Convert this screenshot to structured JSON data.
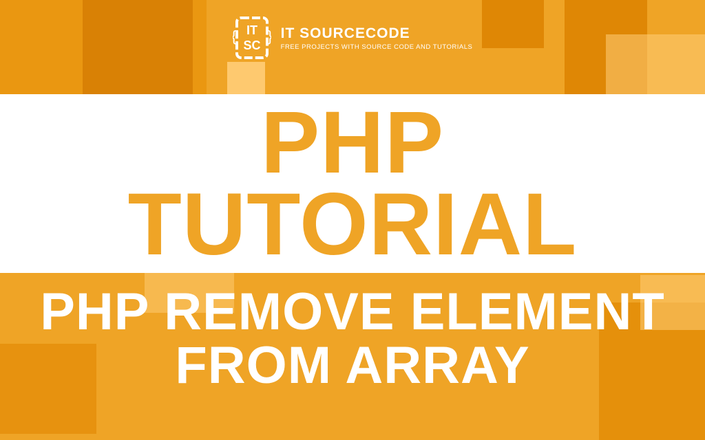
{
  "brand": {
    "name": "IT SOURCECODE",
    "tagline": "FREE PROJECTS WITH SOURCE CODE AND TUTORIALS",
    "logo_letters_top": "IT",
    "logo_letters_bottom": "SC"
  },
  "main_title": {
    "line1": "PHP",
    "line2": "TUTORIAL"
  },
  "sub_title": {
    "line1": "PHP REMOVE ELEMENT",
    "line2": "FROM ARRAY"
  },
  "colors": {
    "accent": "#EFA426",
    "white": "#FFFFFF"
  }
}
